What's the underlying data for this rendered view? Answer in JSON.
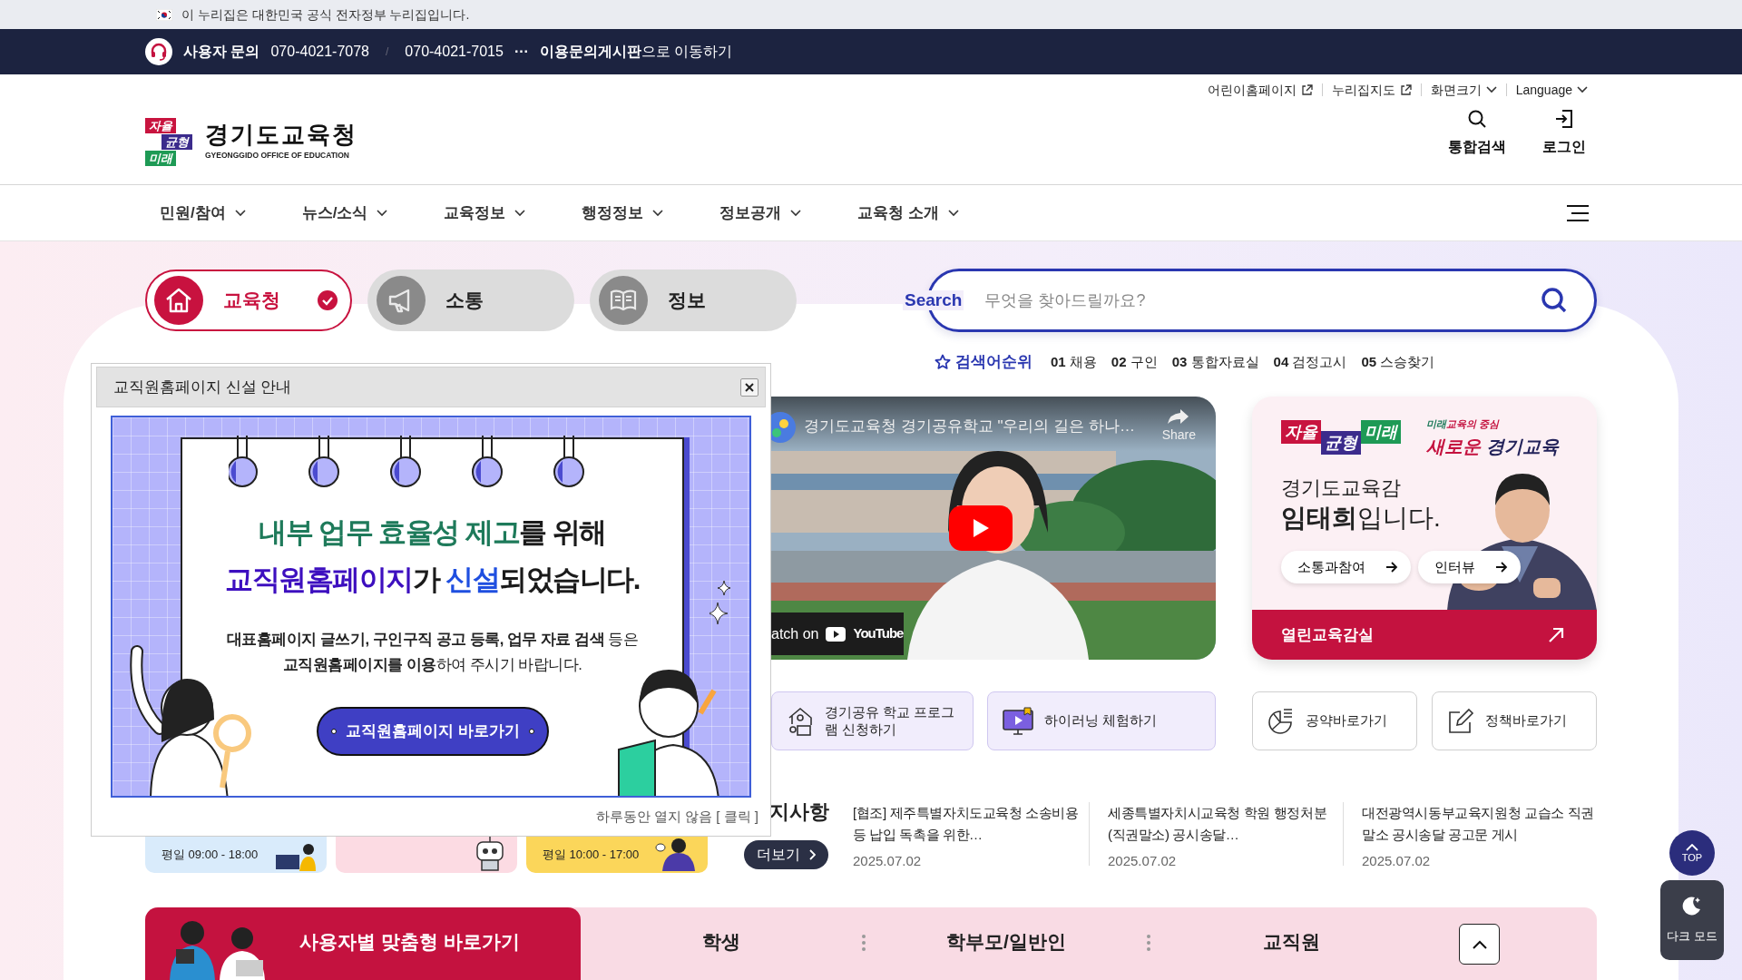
{
  "gov_banner": {
    "text": "이 누리집은 대한민국 공식 전자정부 누리집입니다."
  },
  "contact_bar": {
    "label": "사용자 문의",
    "phones": [
      "070-4021-7078",
      "070-4021-7015"
    ],
    "separator": "/",
    "more": "···",
    "board_link": "**이용문의게시판**으로 이동하기"
  },
  "utility_links": [
    {
      "label": "어린이홈페이지",
      "kind": "external"
    },
    {
      "label": "누리집지도",
      "kind": "external"
    },
    {
      "label": "화면크기",
      "kind": "dropdown"
    },
    {
      "label": "Language",
      "kind": "dropdown"
    }
  ],
  "logo": {
    "tiles": [
      "자율",
      "균형",
      "미래"
    ],
    "name": "경기도교육청",
    "subtitle": "GYEONGGIDO OFFICE OF EDUCATION"
  },
  "header_actions": [
    {
      "label": "통합검색"
    },
    {
      "label": "로그인"
    }
  ],
  "nav": [
    "민원/참여",
    "뉴스/소식",
    "교육정보",
    "행정정보",
    "정보공개",
    "교육청 소개"
  ],
  "categories": [
    {
      "label": "교육청",
      "selected": true
    },
    {
      "label": "소통",
      "selected": false
    },
    {
      "label": "정보",
      "selected": false
    }
  ],
  "search": {
    "label": "Search",
    "placeholder": "무엇을 찾아드릴까요?"
  },
  "ranking": {
    "title": "검색어순위",
    "items": [
      {
        "rank": "01",
        "term": "채용"
      },
      {
        "rank": "02",
        "term": "구인"
      },
      {
        "rank": "03",
        "term": "통합자료실"
      },
      {
        "rank": "04",
        "term": "검정고시"
      },
      {
        "rank": "05",
        "term": "스승찾기"
      }
    ]
  },
  "popup": {
    "title": "교직원홈페이지 신설 안내",
    "headline": [
      [
        {
          "text": "내부 업무 효율성 제고",
          "kind": "green"
        },
        {
          "text": "를 위해",
          "kind": "plain"
        }
      ],
      [
        {
          "text": "교직원홈페이지",
          "kind": "purple"
        },
        {
          "text": "가 ",
          "kind": "plain"
        },
        {
          "text": "신설",
          "kind": "blue"
        },
        {
          "text": "되었습니다.",
          "kind": "plain"
        }
      ]
    ],
    "body": [
      "**대표홈페이지 글쓰기, 구인구직 공고 등록, 업무 자료 검색** 등은",
      "**교직원홈페이지를 이용**하여 주시기 바랍니다."
    ],
    "button": "교직원홈페이지 바로가기",
    "footer": "하루동안 열지 않음 [ 클릭 ]"
  },
  "video": {
    "title": "경기도교육청 경기공유학교 \"우리의 길은 하나…",
    "share": "Share",
    "watch": "atch on",
    "brand": "YouTube"
  },
  "promo": {
    "tiles": [
      "자율",
      "균형",
      "미래"
    ],
    "tagline": [
      {
        "text": "미래",
        "kind": "green"
      },
      {
        "text": "교육의 중심",
        "kind": "red"
      }
    ],
    "slogan": [
      {
        "text": "새로운",
        "kind": "red"
      },
      {
        "text": " 경기교육",
        "kind": "navy"
      }
    ],
    "greeting": "경기도교육감",
    "name_line": "**임태희**입니다.",
    "buttons": [
      "소통과참여",
      "인터뷰"
    ],
    "footer": "열린교육감실"
  },
  "shortcuts": [
    {
      "label": "경기공유 학교 프로그램 신청하기",
      "kind": "tinted"
    },
    {
      "label": "하이러닝 체험하기",
      "kind": "tinted"
    },
    {
      "label": "공약바로가기",
      "kind": "outline"
    },
    {
      "label": "정책바로가기",
      "kind": "outline"
    }
  ],
  "quick_cards": [
    {
      "hours": "평일 09:00 - 18:00",
      "color": "#d9ebfb"
    },
    {
      "color": "#fcdbe3"
    },
    {
      "hours": "평일 10:00 - 17:00",
      "color": "#fbd65a"
    }
  ],
  "notices": {
    "title": "지사항",
    "more": "더보기",
    "items": [
      {
        "title": "[협조] 제주특별자치도교육청 소송비용 등 납입 독촉을 위한…",
        "date": "2025.07.02"
      },
      {
        "title": "세종특별자치시교육청 학원 행정처분(직권말소) 공시송달…",
        "date": "2025.07.02"
      },
      {
        "title": "대전광역시동부교육지원청 교습소 직권말소 공시송달 공고문 게시",
        "date": "2025.07.02"
      }
    ]
  },
  "audience_bar": {
    "title": "사용자별 맞춤형 바로가기",
    "tabs": [
      "학생",
      "학부모/일반인",
      "교직원"
    ]
  },
  "floating": {
    "top": "TOP",
    "dark_mode": "다크 모드"
  }
}
